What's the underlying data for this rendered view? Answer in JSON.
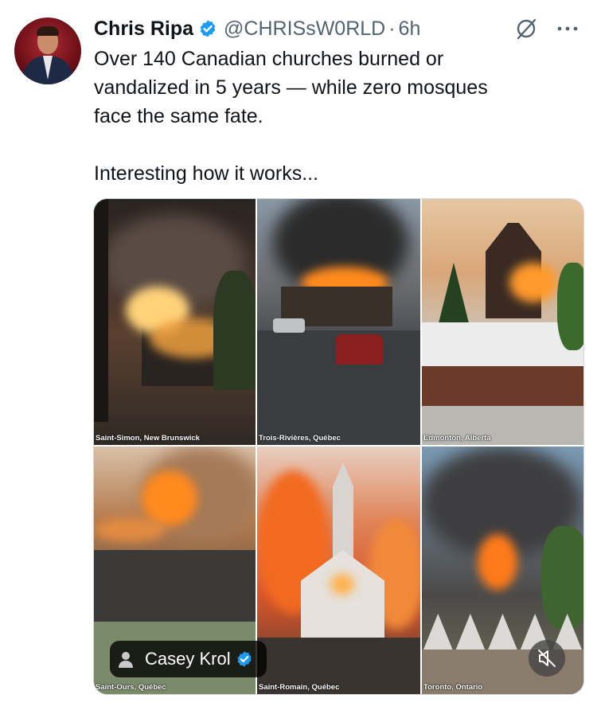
{
  "author": {
    "name": "Chris Ripa",
    "handle": "@CHRISsW0RLD",
    "separator": "·",
    "time": "6h",
    "verified": true,
    "verified_color": "#1d9bf0"
  },
  "header_icons": [
    "grok-icon",
    "more-icon"
  ],
  "tweet": {
    "text": "Over 140 Canadian churches burned or\nvandalized in 5 years — while zero mosques\nface the same fate.\n\nInteresting how it works..."
  },
  "media": {
    "captions": [
      "Saint-Simon, New Brunswick",
      "Trois-Rivières, Québec",
      "Edmonton, Alberta",
      "Saint-Ours, Québec",
      "Saint-Romain, Québec",
      "Toronto, Ontario"
    ],
    "tagged_user": "Casey Krol",
    "tagged_user_verified": true,
    "mute_icon": "volume-off-icon"
  }
}
